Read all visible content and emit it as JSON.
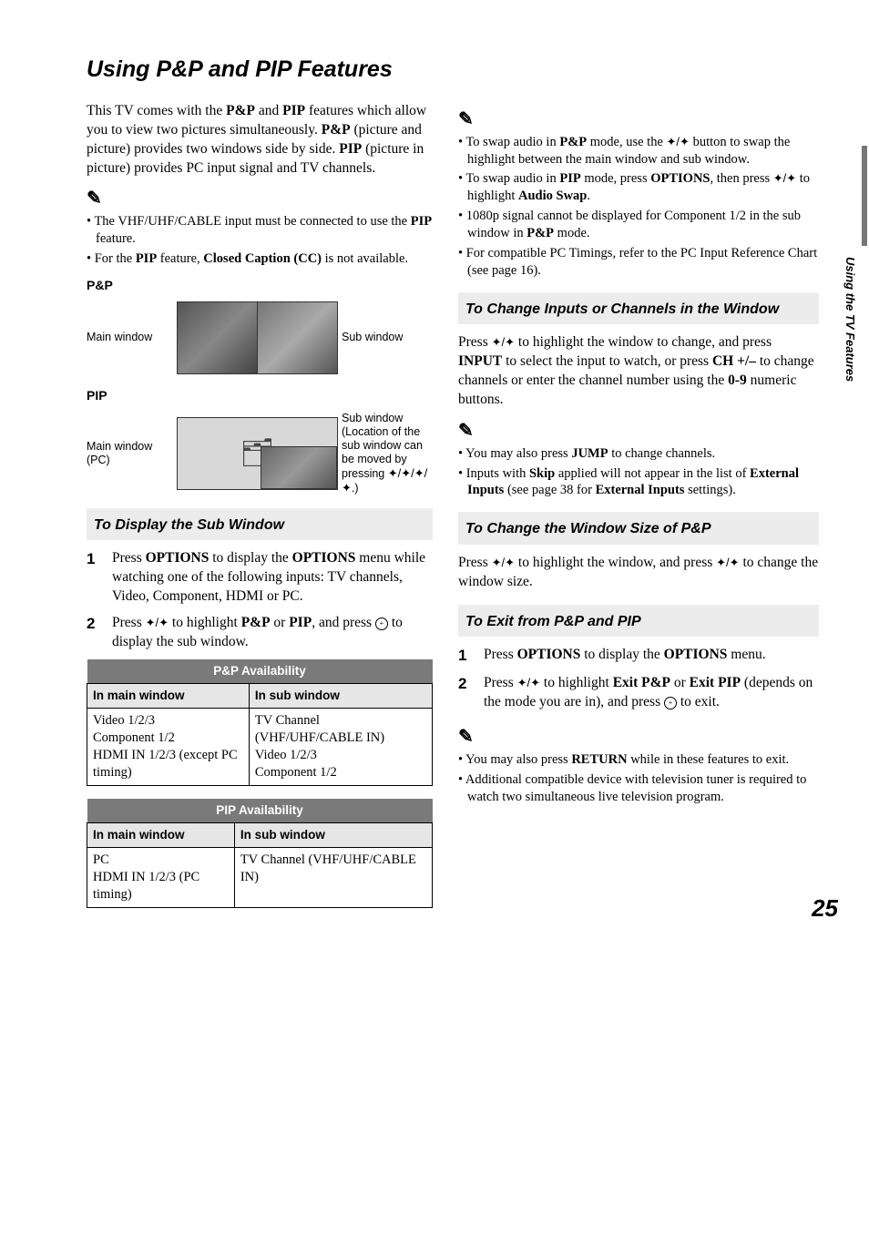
{
  "page": {
    "title": "Using P&P and PIP Features",
    "sideTab": "Using the TV Features",
    "pageNum": "25"
  },
  "left": {
    "intro": "This TV comes with the <b>P&P</b> and <b>PIP</b> features which allow you to view two pictures simultaneously. <b>P&P</b> (picture and picture) provides two windows side by side. <b>PIP</b> (picture in picture) provides PC input signal and TV channels.",
    "notes1": [
      "The VHF/UHF/CABLE input must be connected to use the <b>PIP</b> feature.",
      "For the <b>PIP</b> feature, <b>Closed Caption (CC)</b> is not available."
    ],
    "ppLabel": "P&P",
    "ppMain": "Main window",
    "ppSub": "Sub window",
    "pipLabel": "PIP",
    "pipMain": "Main window (PC)",
    "pipSub": "Sub window (Location of the sub window can be moved by pressing <span class='arrows'>✦/✦/✦/✦</span>.)",
    "sec1Title": "To Display the Sub Window",
    "step1": "Press <b>OPTIONS</b> to display the <b>OPTIONS</b> menu while watching one of the following inputs: TV channels, Video, Component, HDMI or PC.",
    "step2": "Press <span class='arrows'>✦/✦</span> to highlight <b>P&P</b> or <b>PIP</b>, and press <span class='enter-icon'>+</span> to display the sub window.",
    "tablePP": {
      "caption": "P&P Availability",
      "h1": "In main window",
      "h2": "In sub window",
      "c1": "Video 1/2/3\nComponent 1/2\nHDMI IN 1/2/3 (except PC timing)",
      "c2": "TV Channel (VHF/UHF/CABLE IN)\nVideo 1/2/3\nComponent 1/2"
    },
    "tablePIP": {
      "caption": "PIP Availability",
      "h1": "In main window",
      "h2": "In sub window",
      "c1": "PC\nHDMI IN 1/2/3 (PC timing)",
      "c2": "TV Channel (VHF/UHF/CABLE IN)"
    }
  },
  "right": {
    "notes2": [
      "To swap audio in <b>P&P</b> mode, use the <span class='arrows'>✦/✦</span> button to swap the highlight between the main window and sub window.",
      "To swap audio in <b>PIP</b> mode, press <b>OPTIONS</b>, then press <span class='arrows'>✦/✦</span> to highlight <b>Audio Swap</b>.",
      "1080p signal cannot be displayed for Component 1/2 in the sub window in <b>P&P</b> mode.",
      "For compatible PC Timings, refer to the PC Input Reference Chart (see page 16)."
    ],
    "sec2Title": "To Change Inputs or Channels in the Window",
    "sec2Body": "Press <span class='arrows'>✦/✦</span> to highlight the window to change, and press <b>INPUT</b> to select the input to watch, or press <b>CH +/–</b> to change channels or enter the channel number using the <b>0-9</b> numeric buttons.",
    "notes3": [
      "You may also press <b>JUMP</b> to change channels.",
      "Inputs with <b>Skip</b> applied will not appear in the list of <b>External Inputs</b> (see page 38 for <b>External Inputs</b> settings)."
    ],
    "sec3Title": "To Change the Window Size of P&P",
    "sec3Body": "Press <span class='arrows'>✦/✦</span> to highlight the window, and press <span class='arrows'>✦/✦</span> to change the window size.",
    "sec4Title": "To Exit from P&P and PIP",
    "step4_1": "Press <b>OPTIONS</b> to display the <b>OPTIONS</b> menu.",
    "step4_2": "Press <span class='arrows'>✦/✦</span> to highlight <b>Exit P&P</b> or <b>Exit PIP</b> (depends on the mode you are in), and press <span class='enter-icon'>+</span> to exit.",
    "notes4": [
      "You may also press <b>RETURN</b> while in these features to exit.",
      "Additional compatible device with television tuner is required to watch two simultaneous live television program."
    ]
  }
}
